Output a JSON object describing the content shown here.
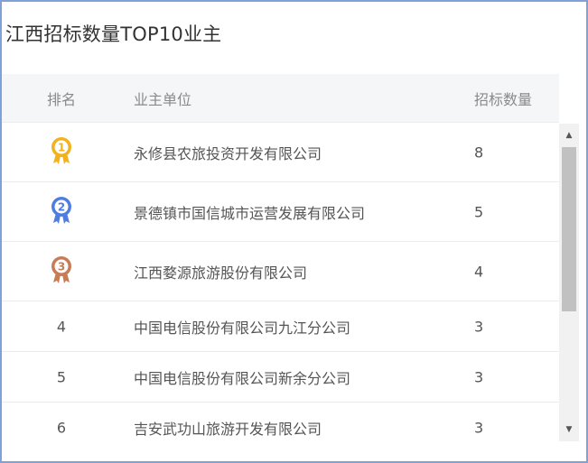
{
  "panel": {
    "title": "江西招标数量TOP10业主"
  },
  "table": {
    "columns": {
      "rank": "排名",
      "owner": "业主单位",
      "count": "招标数量"
    },
    "rows": [
      {
        "rank": "1",
        "medal": "gold-medal-icon",
        "owner": "永修县农旅投资开发有限公司",
        "count": "8"
      },
      {
        "rank": "2",
        "medal": "silver-medal-icon",
        "owner": "景德镇市国信城市运营发展有限公司",
        "count": "5"
      },
      {
        "rank": "3",
        "medal": "bronze-medal-icon",
        "owner": "江西婺源旅游股份有限公司",
        "count": "4"
      },
      {
        "rank": "4",
        "owner": "中国电信股份有限公司九江分公司",
        "count": "3"
      },
      {
        "rank": "5",
        "owner": "中国电信股份有限公司新余分公司",
        "count": "3"
      },
      {
        "rank": "6",
        "owner": "吉安武功山旅游开发有限公司",
        "count": "3"
      }
    ]
  },
  "colors": {
    "border": "#7fa1d8",
    "header_bg": "#f5f6f8",
    "gold": "#f2b21d",
    "silver": "#4f7de0",
    "bronze": "#c77c55"
  },
  "icons": {
    "scroll_up": "▲",
    "scroll_down": "▼"
  }
}
